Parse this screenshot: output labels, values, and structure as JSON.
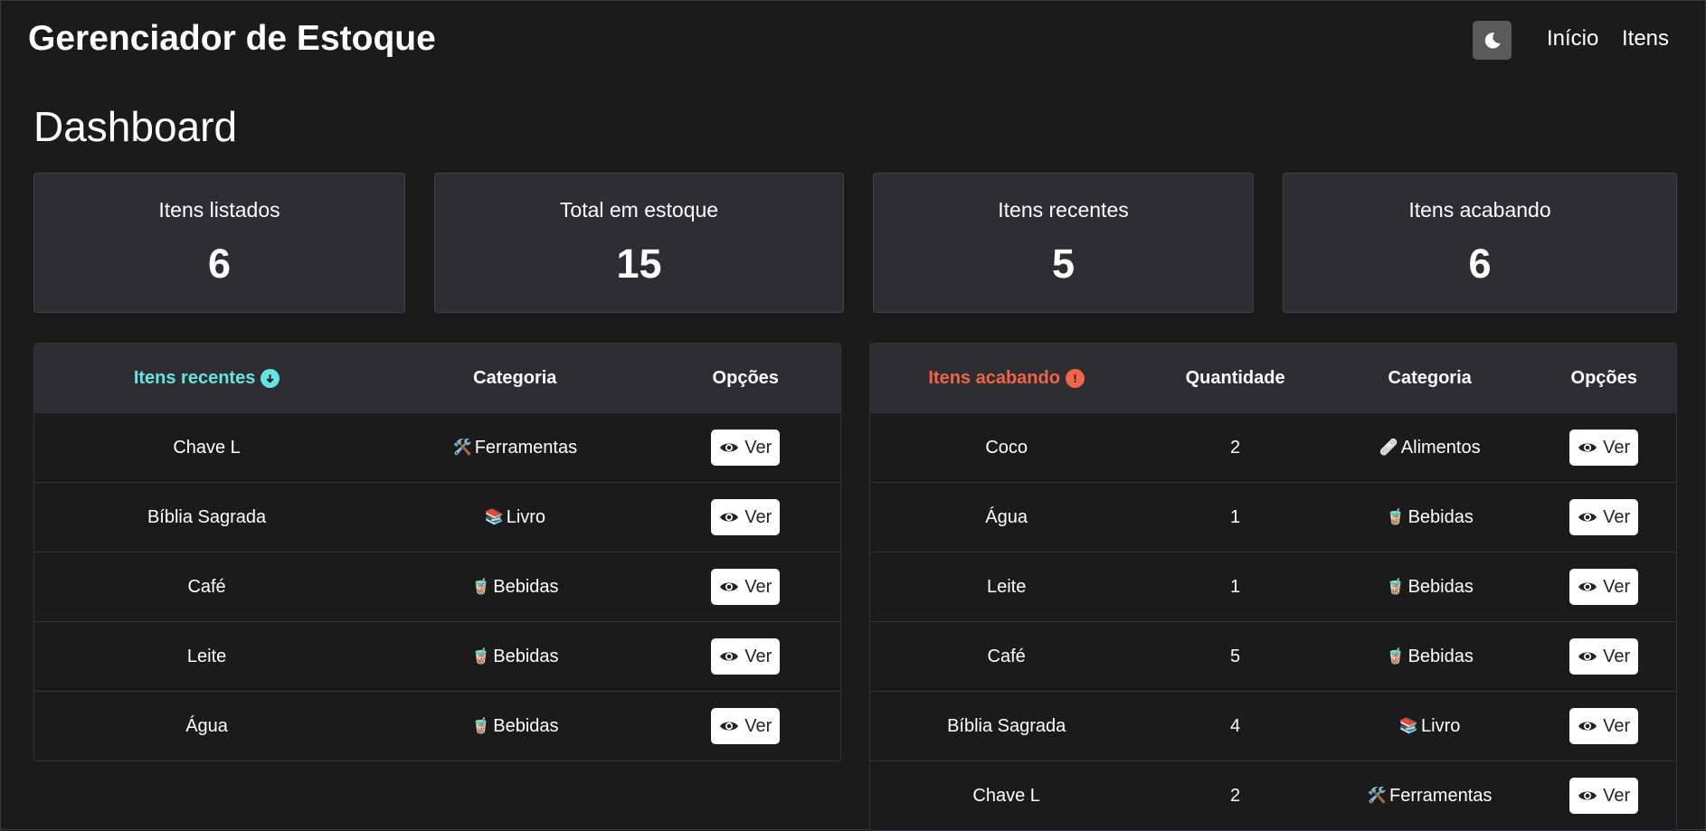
{
  "header": {
    "brand": "Gerenciador de Estoque",
    "theme_icon": "moon-icon",
    "nav": [
      "Início",
      "Itens"
    ]
  },
  "page_title": "Dashboard",
  "stats": [
    {
      "label": "Itens listados",
      "value": "6"
    },
    {
      "label": "Total em estoque",
      "value": "15"
    },
    {
      "label": "Itens recentes",
      "value": "5"
    },
    {
      "label": "Itens acabando",
      "value": "6"
    }
  ],
  "recent": {
    "title": "Itens recentes",
    "title_color": "#66e3e3",
    "title_icon": "arrow-down-circle-icon",
    "headers": [
      "Categoria",
      "Opções"
    ],
    "rows": [
      {
        "name": "Chave L",
        "category": "Ferramentas",
        "category_icon": "🛠️",
        "action": "Ver"
      },
      {
        "name": "Bíblia Sagrada",
        "category": "Livro",
        "category_icon": "📚",
        "action": "Ver"
      },
      {
        "name": "Café",
        "category": "Bebidas",
        "category_icon": "🧋",
        "action": "Ver"
      },
      {
        "name": "Leite",
        "category": "Bebidas",
        "category_icon": "🧋",
        "action": "Ver"
      },
      {
        "name": "Água",
        "category": "Bebidas",
        "category_icon": "🧋",
        "action": "Ver"
      }
    ]
  },
  "low": {
    "title": "Itens acabando",
    "title_color": "#f06548",
    "title_icon": "exclamation-circle-icon",
    "headers": [
      "Quantidade",
      "Categoria",
      "Opções"
    ],
    "rows": [
      {
        "name": "Coco",
        "qty": "2",
        "category": "Alimentos",
        "category_icon": "🩹",
        "action": "Ver"
      },
      {
        "name": "Água",
        "qty": "1",
        "category": "Bebidas",
        "category_icon": "🧋",
        "action": "Ver"
      },
      {
        "name": "Leite",
        "qty": "1",
        "category": "Bebidas",
        "category_icon": "🧋",
        "action": "Ver"
      },
      {
        "name": "Café",
        "qty": "5",
        "category": "Bebidas",
        "category_icon": "🧋",
        "action": "Ver"
      },
      {
        "name": "Bíblia Sagrada",
        "qty": "4",
        "category": "Livro",
        "category_icon": "📚",
        "action": "Ver"
      },
      {
        "name": "Chave L",
        "qty": "2",
        "category": "Ferramentas",
        "category_icon": "🛠️",
        "action": "Ver"
      }
    ]
  }
}
